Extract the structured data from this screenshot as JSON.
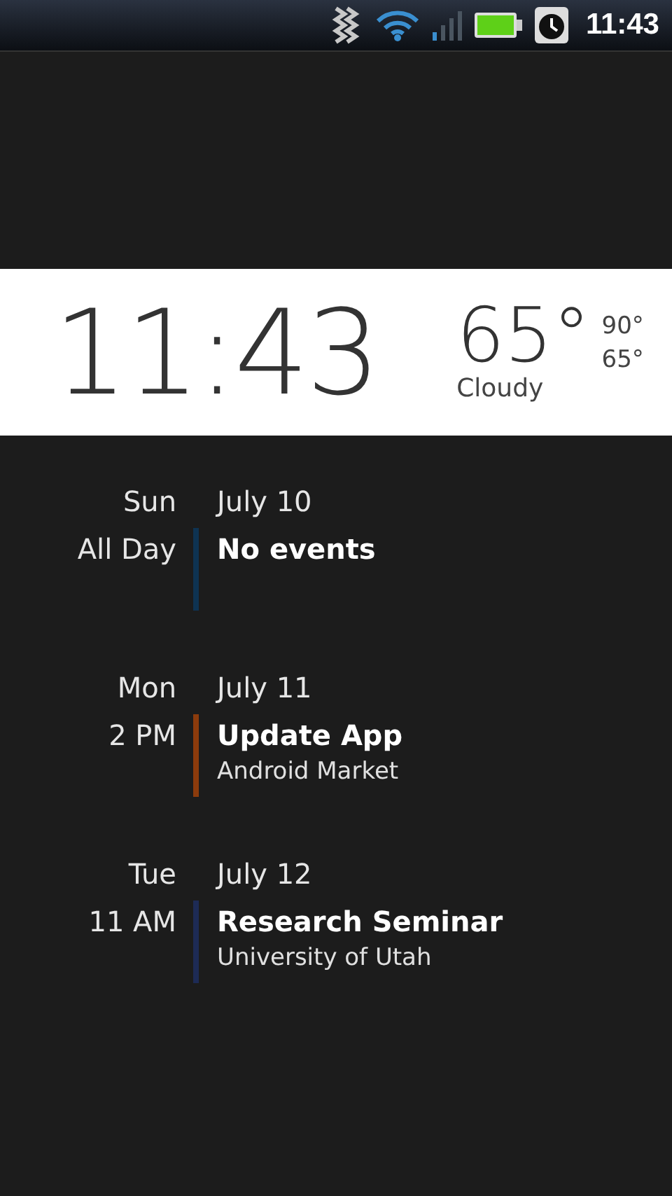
{
  "status_bar": {
    "time": "11:43"
  },
  "clock_widget": {
    "time": "11:43",
    "temperature": "65°",
    "high": "90°",
    "low": "65°",
    "condition": "Cloudy"
  },
  "agenda": [
    {
      "day": "Sun",
      "date": "July 10",
      "events": [
        {
          "time": "All Day",
          "title": "No events",
          "color": "#0e3352"
        }
      ]
    },
    {
      "day": "Mon",
      "date": "July 11",
      "events": [
        {
          "time": "2 PM",
          "title": "Update App",
          "location": "Android Market",
          "color": "#8c3b0c"
        }
      ]
    },
    {
      "day": "Tue",
      "date": "July 12",
      "events": [
        {
          "time": "11 AM",
          "title": "Research Seminar",
          "location": "University of Utah",
          "color": "#1d2b55"
        }
      ]
    }
  ]
}
